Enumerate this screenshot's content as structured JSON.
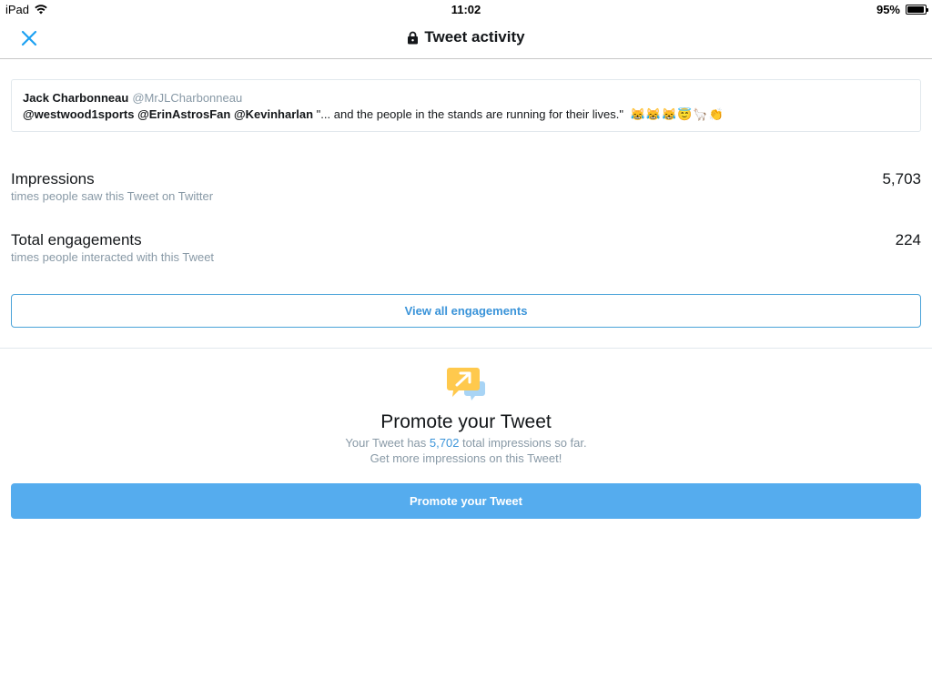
{
  "status_bar": {
    "device": "iPad",
    "time": "11:02",
    "battery": "95%",
    "battery_level": 0.95
  },
  "nav": {
    "title": "Tweet activity",
    "close_icon": "close-icon",
    "lock_icon": "lock-icon"
  },
  "tweet": {
    "name": "Jack Charbonneau",
    "handle": "@MrJLCharbonneau",
    "mentions": "@westwood1sports @ErinAstrosFan @Kevinharlan",
    "text": "\"... and the people in the stands are running for their lives.\"",
    "emojis": "😹😹😹😇🦙👏"
  },
  "stats": {
    "impressions": {
      "label": "Impressions",
      "sub": "times people saw this Tweet on Twitter",
      "value": "5,703"
    },
    "engagements": {
      "label": "Total engagements",
      "sub": "times people interacted with this Tweet",
      "value": "224"
    }
  },
  "view_all_label": "View all engagements",
  "promote": {
    "icon": "promote-chat-icon",
    "title": "Promote your Tweet",
    "line1_prefix": "Your Tweet has ",
    "line1_count": "5,702",
    "line1_suffix": " total impressions so far.",
    "line2": "Get more impressions on this Tweet!",
    "button_label": "Promote your Tweet"
  },
  "colors": {
    "accent": "#55acee",
    "link": "#3b94d9",
    "secondary_text": "#8899a6",
    "promote_icon": "#ffc94d"
  }
}
